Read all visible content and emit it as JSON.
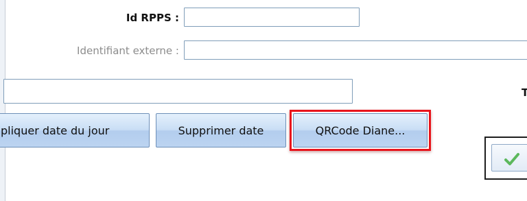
{
  "form": {
    "rpps_label": "Id RPPS :",
    "rpps_value": "",
    "external_id_label": "Identifiant externe :",
    "external_id_value": "",
    "third_field_value": "",
    "cut_label_char": "T"
  },
  "buttons": {
    "apply_date": "pliquer date du jour",
    "delete_date": "Supprimer date",
    "qrcode": "QRCode Diane..."
  },
  "icons": {
    "validate": "check-icon"
  },
  "colors": {
    "highlight": "#e8141b",
    "check": "#5cb85c"
  }
}
